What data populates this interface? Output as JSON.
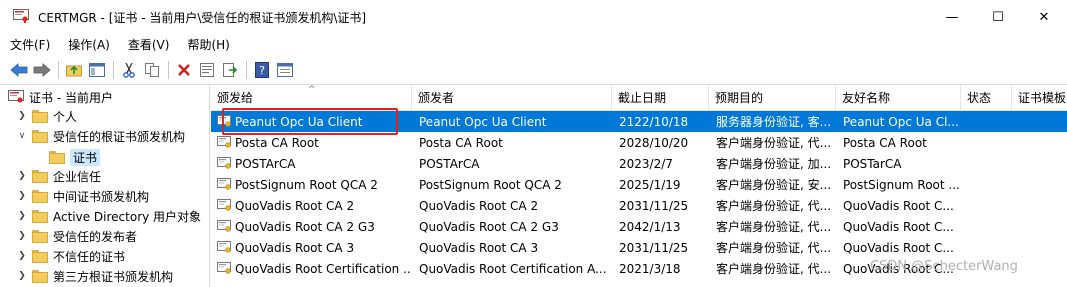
{
  "window": {
    "title": "CERTMGR - [证书 - 当前用户\\受信任的根证书颁发机构\\证书]",
    "controls": {
      "minimize": "—",
      "maximize": "☐",
      "close": "✕"
    }
  },
  "menu": [
    "文件(F)",
    "操作(A)",
    "查看(V)",
    "帮助(H)"
  ],
  "toolbar_icons": [
    "back-arrow-icon",
    "forward-arrow-icon",
    "up-folder-icon",
    "show-tree-icon",
    "cut-icon",
    "copy-icon",
    "delete-icon",
    "properties-icon",
    "export-icon",
    "help-icon",
    "view-icon"
  ],
  "tree": {
    "root": "证书 - 当前用户",
    "items": [
      {
        "label": "个人",
        "expanded": false
      },
      {
        "label": "受信任的根证书颁发机构",
        "expanded": true
      },
      {
        "label": "证书",
        "selected": true
      },
      {
        "label": "企业信任",
        "expanded": false
      },
      {
        "label": "中间证书颁发机构",
        "expanded": false
      },
      {
        "label": "Active Directory 用户对象",
        "expanded": false
      },
      {
        "label": "受信任的发布者",
        "expanded": false
      },
      {
        "label": "不信任的证书",
        "expanded": false
      },
      {
        "label": "第三方根证书颁发机构",
        "expanded": false
      }
    ]
  },
  "list": {
    "sort_indicator": "^",
    "columns": [
      "颁发给",
      "颁发者",
      "截止日期",
      "预期目的",
      "友好名称",
      "状态",
      "证书模板"
    ],
    "rows": [
      {
        "issued_to": "Peanut Opc Ua Client",
        "issued_by": "Peanut Opc Ua Client",
        "expiry": "2122/10/18",
        "purpose": "服务器身份验证, 客...",
        "friendly": "Peanut Opc Ua Cl...",
        "selected": true
      },
      {
        "issued_to": "Posta CA Root",
        "issued_by": "Posta CA Root",
        "expiry": "2028/10/20",
        "purpose": "客户端身份验证, 代...",
        "friendly": "Posta CA Root"
      },
      {
        "issued_to": "POSTArCA",
        "issued_by": "POSTArCA",
        "expiry": "2023/2/7",
        "purpose": "客户端身份验证, 加...",
        "friendly": "POSTarCA"
      },
      {
        "issued_to": "PostSignum Root QCA 2",
        "issued_by": "PostSignum Root QCA 2",
        "expiry": "2025/1/19",
        "purpose": "客户端身份验证, 安...",
        "friendly": "PostSignum Root ..."
      },
      {
        "issued_to": "QuoVadis Root CA 2",
        "issued_by": "QuoVadis Root CA 2",
        "expiry": "2031/11/25",
        "purpose": "客户端身份验证, 代...",
        "friendly": "QuoVadis Root C..."
      },
      {
        "issued_to": "QuoVadis Root CA 2 G3",
        "issued_by": "QuoVadis Root CA 2 G3",
        "expiry": "2042/1/13",
        "purpose": "客户端身份验证, 代...",
        "friendly": "QuoVadis Root C..."
      },
      {
        "issued_to": "QuoVadis Root CA 3",
        "issued_by": "QuoVadis Root CA 3",
        "expiry": "2031/11/25",
        "purpose": "客户端身份验证, 代...",
        "friendly": "QuoVadis Root C..."
      },
      {
        "issued_to": "QuoVadis Root Certification ...",
        "issued_by": "QuoVadis Root Certification A...",
        "expiry": "2021/3/18",
        "purpose": "客户端身份验证, 代...",
        "friendly": "QuoVadis Root C..."
      }
    ]
  },
  "watermark": "CSDN @SchecterWang",
  "colors": {
    "selection": "#0078d7",
    "tree_selection": "#cce8ff",
    "highlight_box": "#e8201c"
  }
}
